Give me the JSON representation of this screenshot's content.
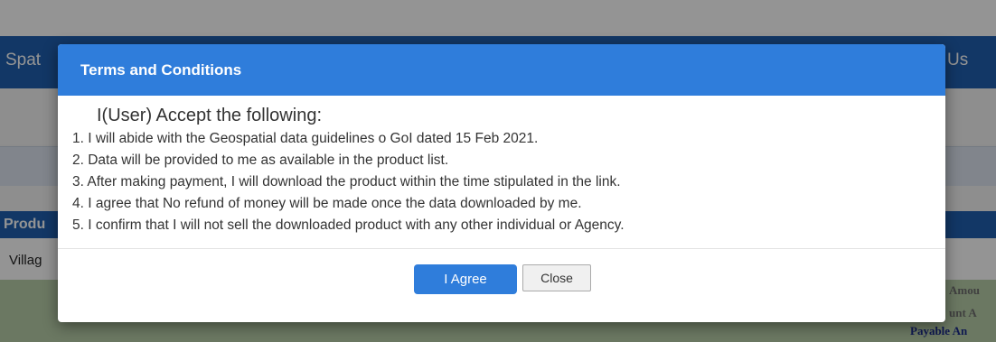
{
  "background": {
    "nav_left": "Spat",
    "nav_right": "Us",
    "table_header": "Produ",
    "row_label": "Villag",
    "amount_1": "Amou",
    "amount_2": "unt A",
    "amount_3": "Payable An"
  },
  "modal": {
    "title": "Terms and Conditions",
    "intro": "I(User) Accept the following:",
    "terms": [
      "1. I will abide with the Geospatial data guidelines o GoI dated 15 Feb 2021.",
      "2. Data will be provided to me as available in the product list.",
      "3. After making payment, I will download the product within the time stipulated in the link.",
      "4. I agree that No refund of money will be made once the data downloaded by me.",
      "5. I confirm that I will not sell the downloaded product with any other individual or Agency."
    ],
    "agree_label": "I Agree",
    "close_label": "Close"
  },
  "colors": {
    "header": "#2f7ddb",
    "primary_button": "#2f7ddb",
    "nav": "#1f5fb0"
  }
}
